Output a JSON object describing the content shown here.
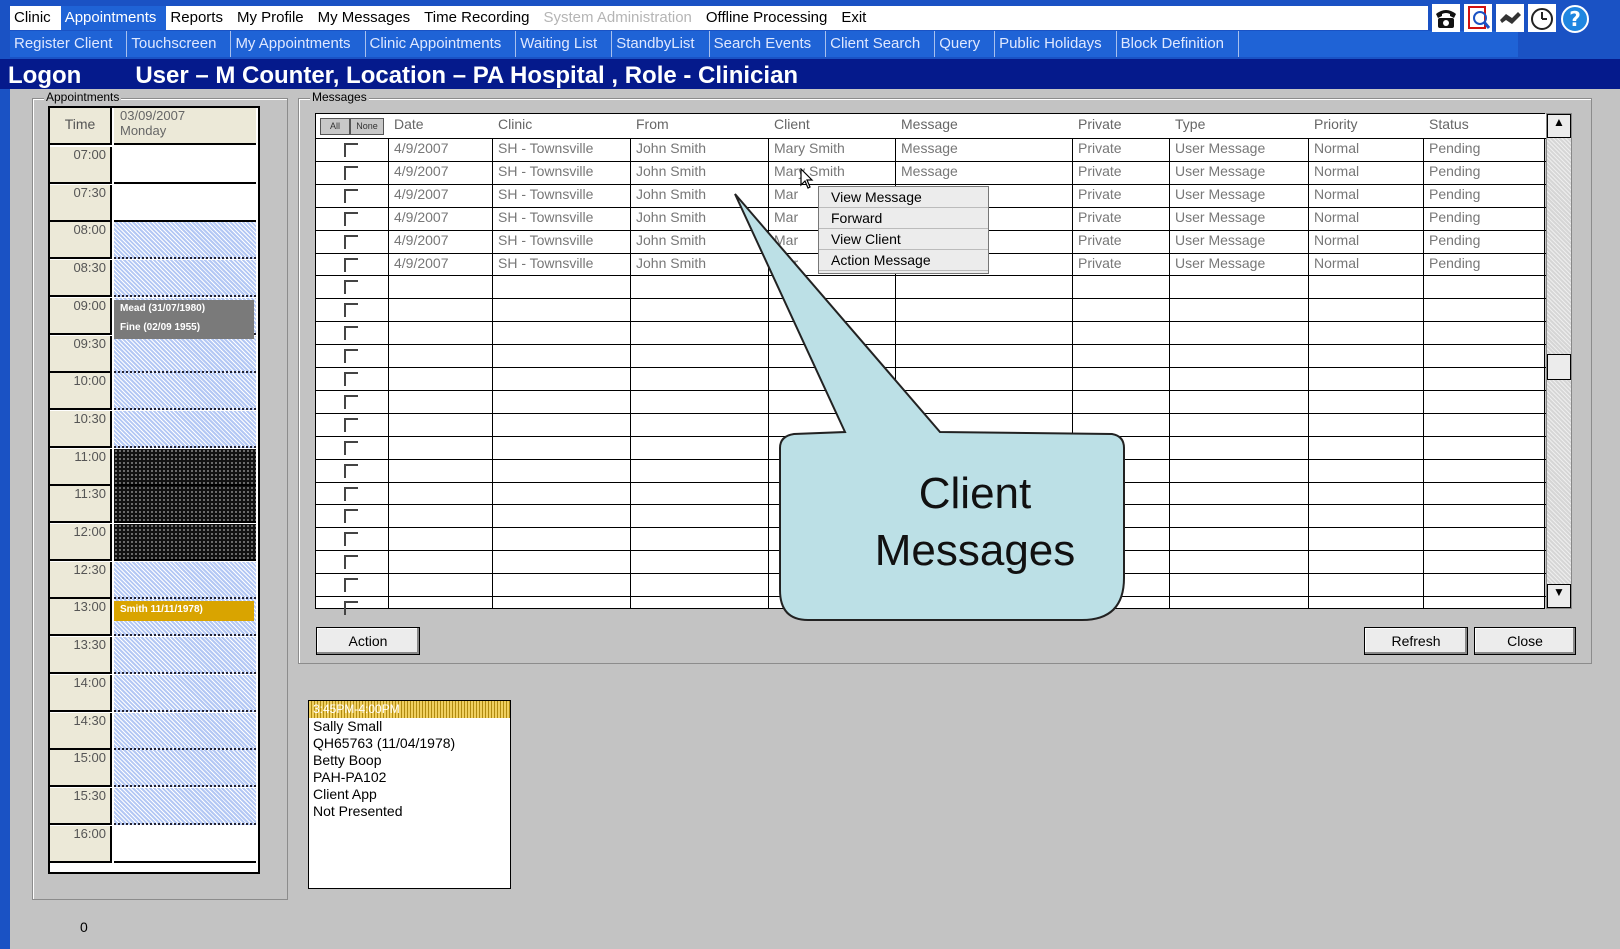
{
  "menu_main": {
    "items": [
      "Clinic",
      "Appointments",
      "Reports",
      "My Profile",
      "My Messages",
      "Time Recording",
      "System Administration",
      "Offline Processing",
      "Exit"
    ],
    "active": "Appointments",
    "disabled": "System Administration"
  },
  "menu_sub": {
    "items": [
      "Register Client",
      "Touchscreen",
      "My Appointments",
      "Clinic Appointments",
      "Waiting List",
      "StandbyList",
      "Search Events",
      "Client Search",
      "Query",
      "Public Holidays",
      "Block Definition"
    ]
  },
  "toolbar_icons": [
    "phone-icon",
    "document-icon",
    "handshake-icon",
    "alarm-clock-icon",
    "help-icon"
  ],
  "title": {
    "left": "Logon",
    "right": "User – M Counter, Location – PA Hospital , Role - Clinician"
  },
  "appointments": {
    "group_label": "Appointments",
    "time_header": "Time",
    "date": "03/09/2007",
    "weekday": "Monday",
    "times": [
      "07:00",
      "07:30",
      "08:00",
      "08:30",
      "09:00",
      "09:30",
      "10:00",
      "10:30",
      "11:00",
      "11:30",
      "12:00",
      "12:30",
      "13:00",
      "13:30",
      "14:00",
      "14:30",
      "15:00",
      "15:30",
      "16:00"
    ],
    "bookings": [
      {
        "label": "Mead (31/07/1980)",
        "color": "#7a7a7a"
      },
      {
        "label": "Fine (02/09 1955)",
        "color": "#7a7a7a"
      },
      {
        "label": "Smith 11/11/1978)",
        "color": "#d9a400"
      }
    ]
  },
  "messages": {
    "group_label": "Messages",
    "select_all": "All",
    "select_none": "None",
    "columns": [
      "Date",
      "Clinic",
      "From",
      "Client",
      "Message",
      "Private",
      "Type",
      "Priority",
      "Status"
    ],
    "rows": [
      [
        "4/9/2007",
        "SH - Townsville",
        "John Smith",
        "Mary Smith",
        "Message",
        "Private",
        "User Message",
        "Normal",
        "Pending"
      ],
      [
        "4/9/2007",
        "SH - Townsville",
        "John Smith",
        "Mary Smith",
        "Message",
        "Private",
        "User Message",
        "Normal",
        "Pending"
      ],
      [
        "4/9/2007",
        "SH - Townsville",
        "John Smith",
        "Mar",
        "",
        "Private",
        "User Message",
        "Normal",
        "Pending"
      ],
      [
        "4/9/2007",
        "SH - Townsville",
        "John Smith",
        "Mar",
        "",
        "Private",
        "User Message",
        "Normal",
        "Pending"
      ],
      [
        "4/9/2007",
        "SH - Townsville",
        "John Smith",
        "Mar",
        "",
        "Private",
        "User Message",
        "Normal",
        "Pending"
      ],
      [
        "4/9/2007",
        "SH - Townsville",
        "John Smith",
        "Mar",
        "",
        "Private",
        "User Message",
        "Normal",
        "Pending"
      ]
    ],
    "context_menu": [
      "View Message",
      "Forward",
      "View Client",
      "Action Message"
    ],
    "action_button": "Action",
    "refresh_button": "Refresh",
    "close_button": "Close"
  },
  "callout": {
    "line1": "Client",
    "line2": "Messages",
    "fill": "#bce0e6"
  },
  "card": {
    "header": "3:45PM-4:00PM",
    "lines": [
      "Sally Small",
      "QH65763 (11/04/1978)",
      "Betty Boop",
      "PAH-PA102",
      "Client App",
      "Not Presented"
    ]
  },
  "status_count": "0"
}
